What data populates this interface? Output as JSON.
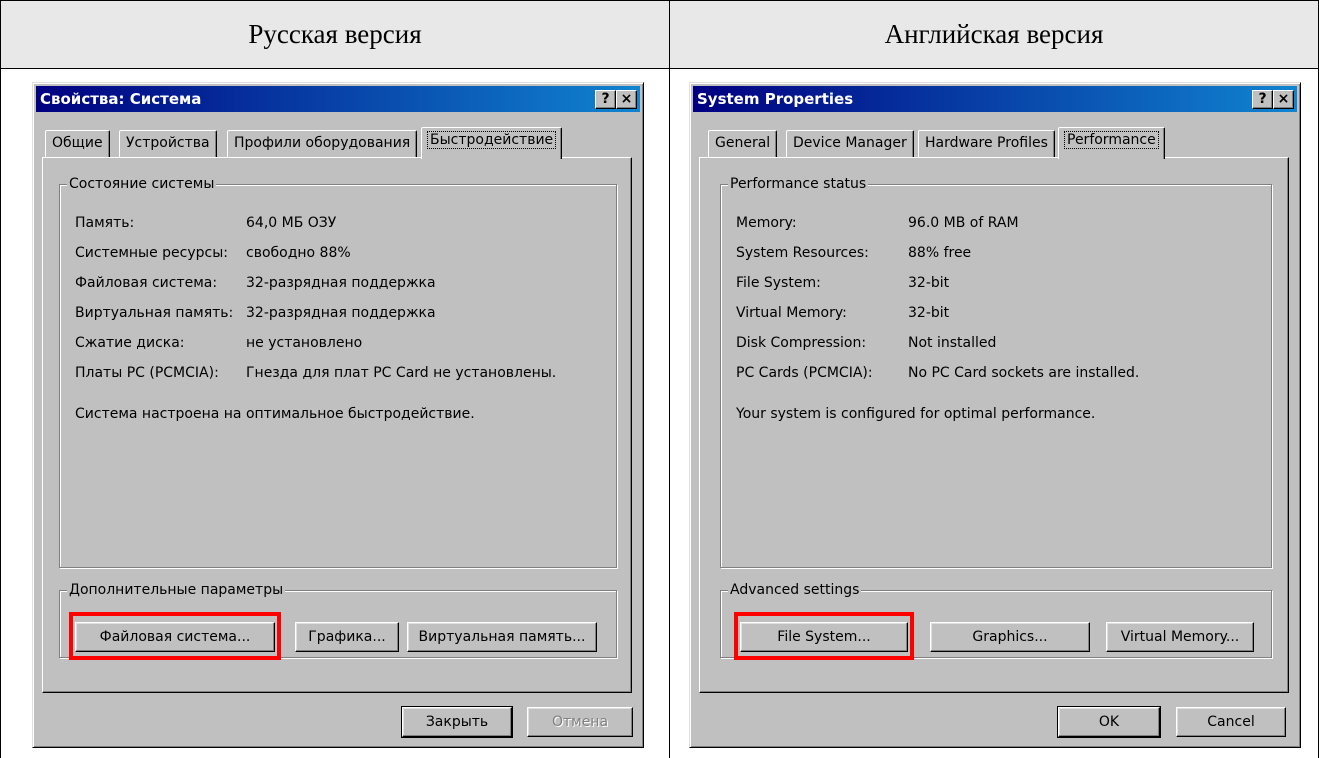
{
  "headers": {
    "left": "Русская версия",
    "right": "Английская версия"
  },
  "ru": {
    "title": "Свойства: Система",
    "help": "?",
    "close": "×",
    "tabs": [
      "Общие",
      "Устройства",
      "Профили оборудования",
      "Быстродействие"
    ],
    "status_group": "Состояние системы",
    "rows": [
      {
        "label": "Память:",
        "value": "64,0 МБ ОЗУ"
      },
      {
        "label": "Системные ресурсы:",
        "value": "свободно 88%"
      },
      {
        "label": "Файловая система:",
        "value": "32-разрядная поддержка"
      },
      {
        "label": "Виртуальная память:",
        "value": "32-разрядная поддержка"
      },
      {
        "label": "Сжатие диска:",
        "value": "не установлено"
      },
      {
        "label": "Платы PC (PCMCIA):",
        "value": "Гнезда для плат PC Card не установлены."
      }
    ],
    "message": "Система настроена на оптимальное быстродействие.",
    "advanced_group": "Дополнительные параметры",
    "buttons": {
      "filesystem": "Файловая система...",
      "graphics": "Графика...",
      "virtual_memory": "Виртуальная память..."
    },
    "ok": "Закрыть",
    "cancel": "Отмена"
  },
  "en": {
    "title": "System Properties",
    "help": "?",
    "close": "×",
    "tabs": [
      "General",
      "Device Manager",
      "Hardware Profiles",
      "Performance"
    ],
    "status_group": "Performance status",
    "rows": [
      {
        "label": "Memory:",
        "value": "96.0 MB of RAM"
      },
      {
        "label": "System Resources:",
        "value": "88% free"
      },
      {
        "label": "File System:",
        "value": "32-bit"
      },
      {
        "label": "Virtual Memory:",
        "value": "32-bit"
      },
      {
        "label": "Disk Compression:",
        "value": "Not installed"
      },
      {
        "label": "PC Cards (PCMCIA):",
        "value": "No PC Card sockets are installed."
      }
    ],
    "message": "Your system is configured for optimal performance.",
    "advanced_group": "Advanced settings",
    "buttons": {
      "filesystem": "File System...",
      "graphics": "Graphics...",
      "virtual_memory": "Virtual Memory..."
    },
    "ok": "OK",
    "cancel": "Cancel"
  },
  "colors": {
    "highlight": "#ff0000",
    "titlebar": "#000080",
    "face": "#c0c0c0"
  }
}
